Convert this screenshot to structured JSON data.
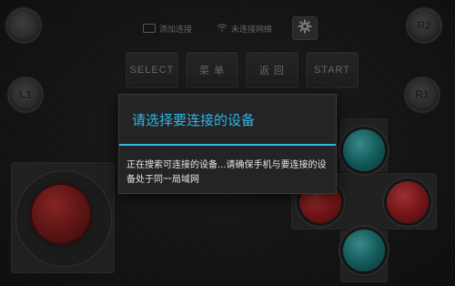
{
  "corner_buttons": {
    "top_left": "",
    "top_right": "R2",
    "mid_left": "L1",
    "mid_right": "R1"
  },
  "status_bar": {
    "add_connection_label": "添加连接",
    "network_status_label": "未连接网络"
  },
  "menu": {
    "select_label": "SELECT",
    "menu_label": "菜 单",
    "back_label": "返 回",
    "start_label": "START"
  },
  "dialog": {
    "title": "请选择要连接的设备",
    "message": "正在搜索可连接的设备...请确保手机与要连接的设备处于同一局域网"
  },
  "colors": {
    "accent": "#33b5e5",
    "action_teal": "#1d7f80",
    "action_red": "#a11f24",
    "joystick_red": "#8a1f1f"
  },
  "icons": {
    "settings": "gear-icon",
    "wifi": "wifi-icon",
    "add_connection": "device-icon"
  }
}
